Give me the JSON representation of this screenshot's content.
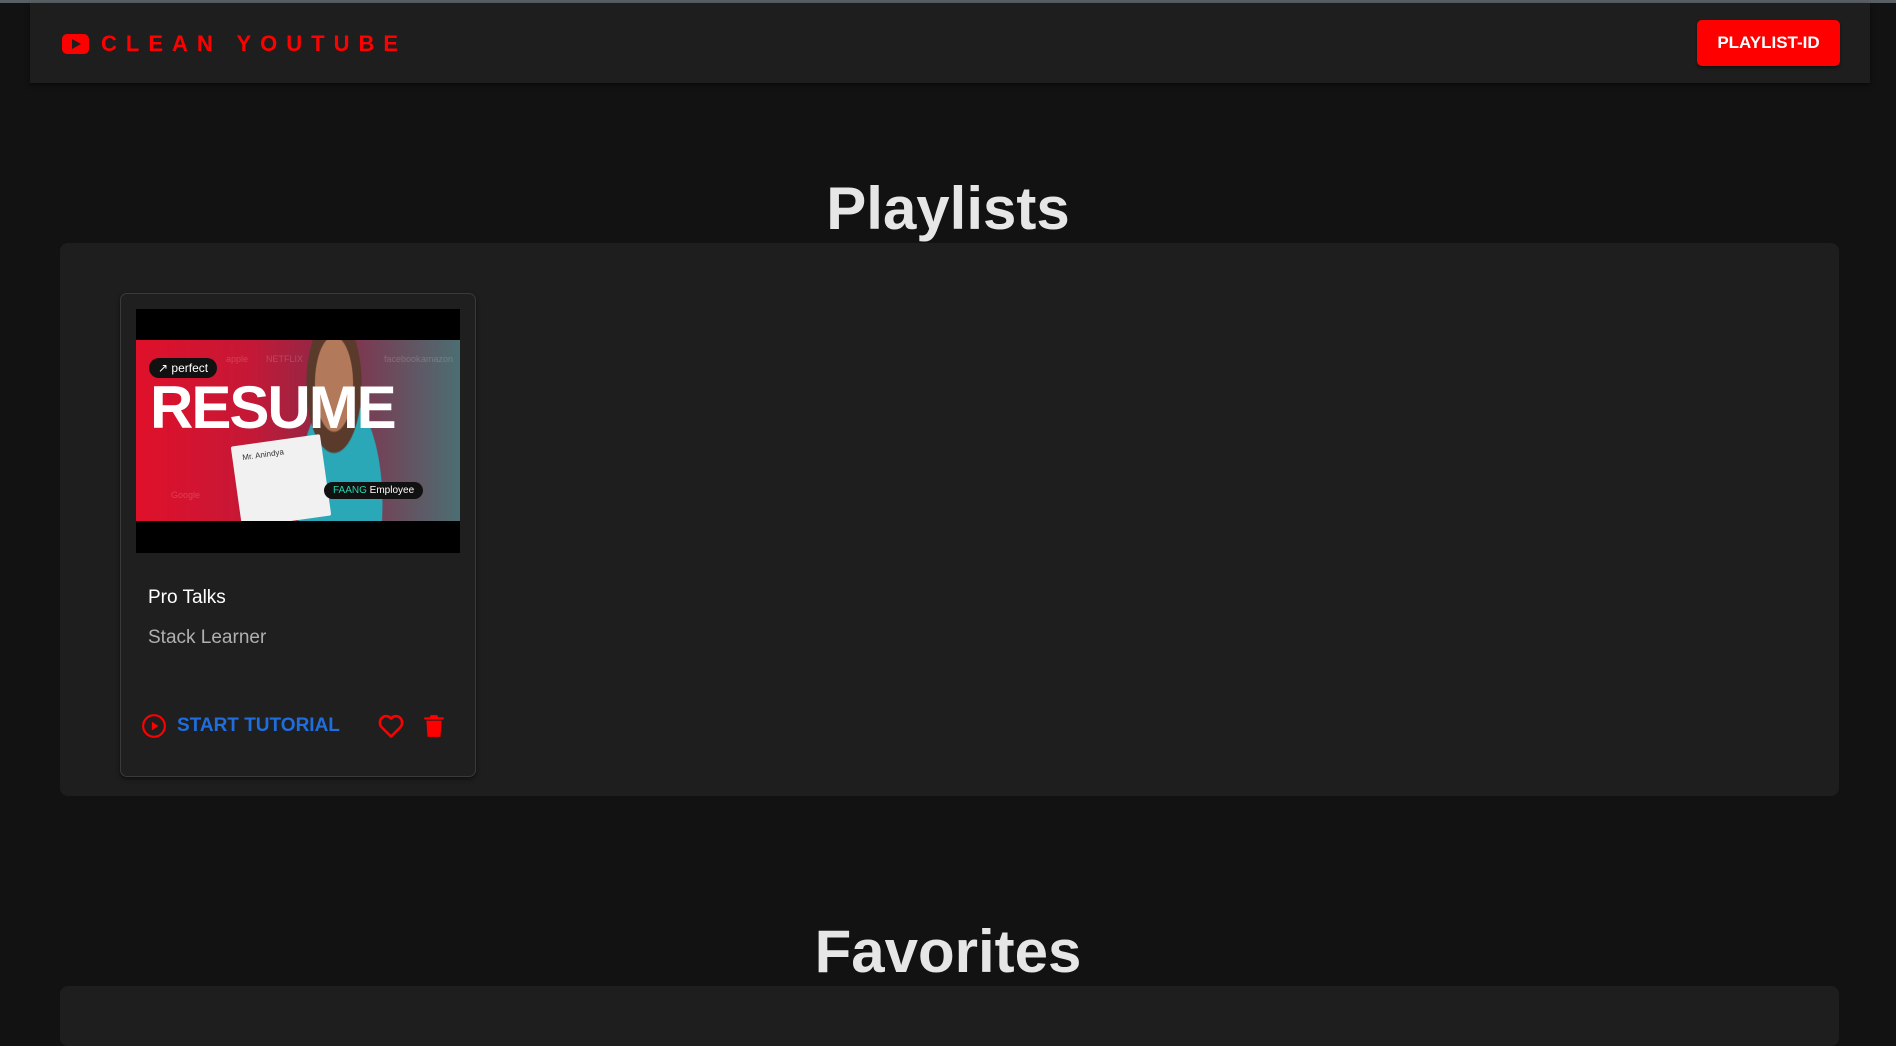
{
  "appbar": {
    "brand_text": "CLEAN YOUTUBE",
    "brand_icon": "youtube-logo-icon",
    "playlist_button_label": "PLAYLIST-ID"
  },
  "sections": {
    "playlists_title": "Playlists",
    "favorites_title": "Favorites"
  },
  "playlists": [
    {
      "title": "Pro Talks",
      "channel": "Stack Learner",
      "thumbnail": {
        "headline": "RESUME",
        "pill_top": "↗ perfect",
        "pill_bottom_accent": "FAANG",
        "pill_bottom_rest": " Employee",
        "paper_text": "Mr. Anindya",
        "faint_words": [
          "apple",
          "NETFLIX",
          "amazon",
          "Google",
          "facebook"
        ]
      },
      "start_label": "START TUTORIAL",
      "icons": {
        "start": "play-circle-icon",
        "favorite": "heart-outline-icon",
        "delete": "trash-icon"
      }
    }
  ],
  "colors": {
    "brand_red": "#ff0000",
    "start_blue": "#1e6ee0",
    "background": "#121212",
    "panel": "#1e1e1e"
  }
}
